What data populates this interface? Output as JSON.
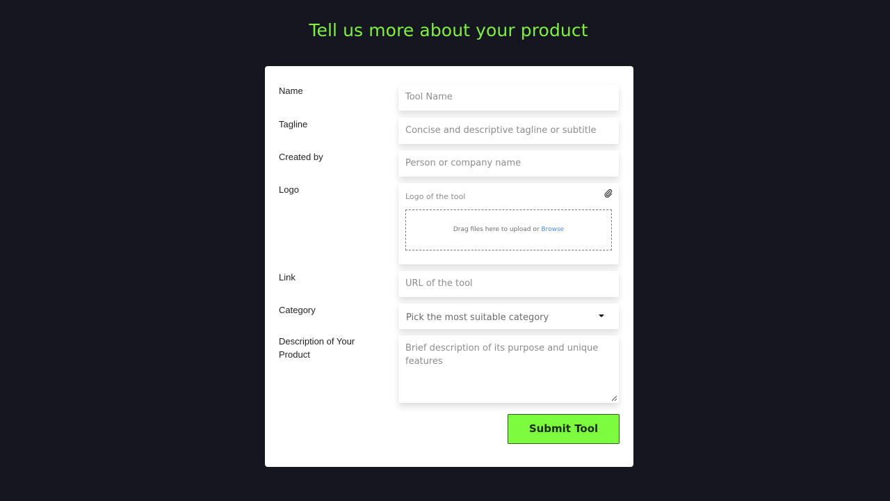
{
  "header": {
    "title": "Tell us more about your product"
  },
  "form": {
    "name": {
      "label": "Name",
      "placeholder": "Tool Name"
    },
    "tagline": {
      "label": "Tagline",
      "placeholder": "Concise and descriptive tagline or subtitle"
    },
    "created_by": {
      "label": "Created by",
      "placeholder": "Person or company name"
    },
    "logo": {
      "label": "Logo",
      "placeholder": "Logo of the tool",
      "dropzone_text": "Drag files here to upload or ",
      "browse_label": "Browse",
      "icon": "paperclip-icon"
    },
    "link": {
      "label": "Link",
      "placeholder": "URL of the tool"
    },
    "category": {
      "label": "Category",
      "placeholder": "Pick the most suitable category",
      "icon": "caret-down-icon"
    },
    "description": {
      "label_line1": "Description of Your",
      "label_line2": "Product",
      "placeholder": "Brief description of its purpose and unique features"
    },
    "submit_label": "Submit Tool"
  },
  "colors": {
    "background": "#161621",
    "accent": "#7bf23c",
    "button": "#7dfb3f",
    "link": "#4f86e8"
  }
}
